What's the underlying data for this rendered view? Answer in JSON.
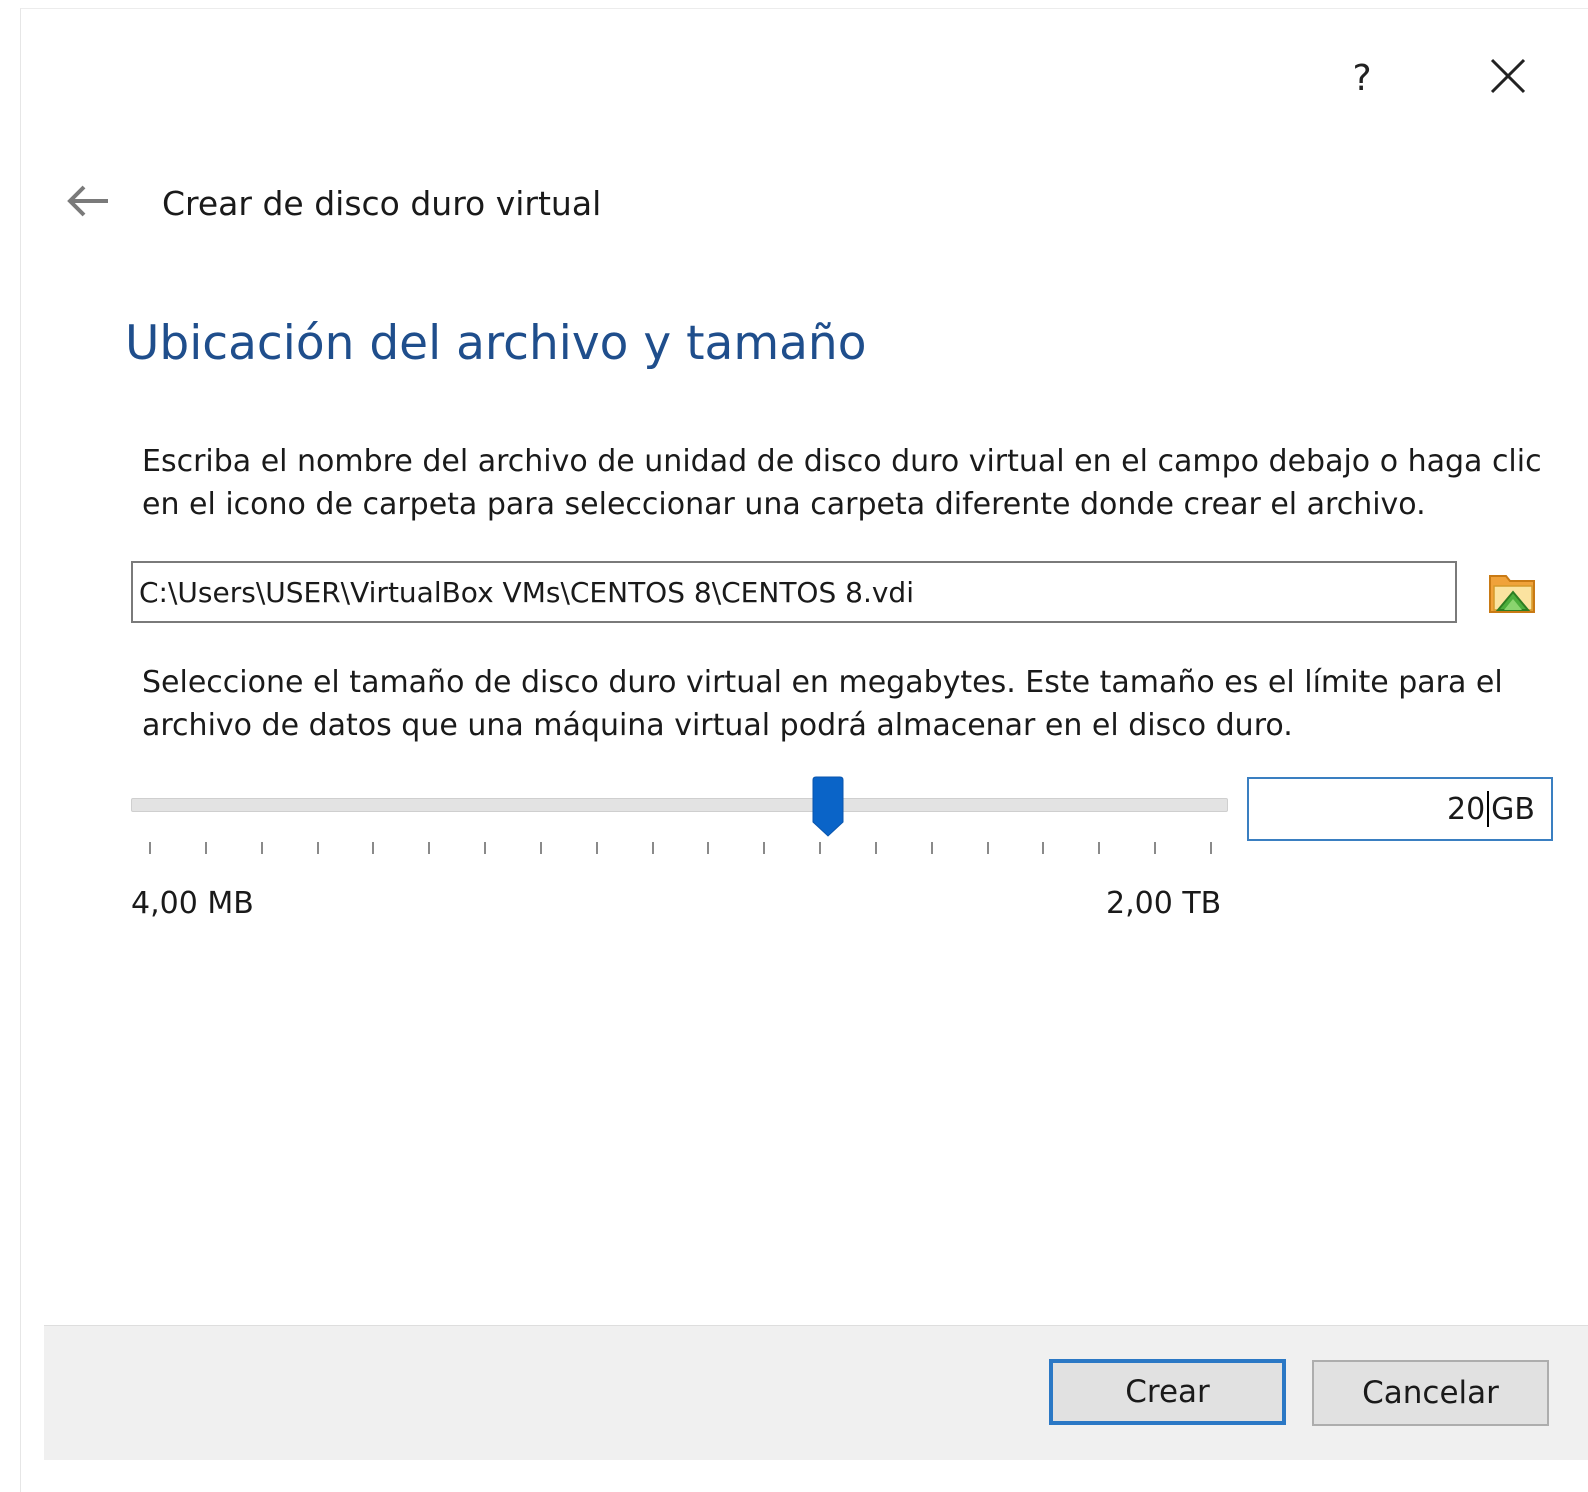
{
  "window": {
    "help_label": "?",
    "close_icon": "close-icon"
  },
  "wizard": {
    "back_icon": "arrow-left-icon",
    "title": "Crear de disco duro virtual"
  },
  "page": {
    "heading": "Ubicación del archivo y tamaño",
    "location_description": "Escriba el nombre del archivo de unidad de disco duro virtual en el campo debajo o haga clic en el icono de carpeta para seleccionar una carpeta diferente donde crear el archivo.",
    "file_path": "C:\\Users\\USER\\VirtualBox VMs\\CENTOS 8\\CENTOS 8.vdi",
    "folder_icon": "folder-open-icon",
    "size_description": "Seleccione el tamaño de disco duro virtual en megabytes. Este tamaño es el límite para el archivo de datos que una máquina virtual podrá almacenar en el disco duro.",
    "size_slider": {
      "min_label": "4,00 MB",
      "max_label": "2,00 TB",
      "position_fraction": 0.64,
      "tick_count": 20
    },
    "size_value": "20",
    "size_unit": "GB"
  },
  "footer": {
    "create_label": "Crear",
    "cancel_label": "Cancelar"
  },
  "colors": {
    "heading": "#1f4e8c",
    "accent": "#0a64c8",
    "default_button_border": "#2b78c5",
    "footer_background": "#f0f0f0"
  }
}
